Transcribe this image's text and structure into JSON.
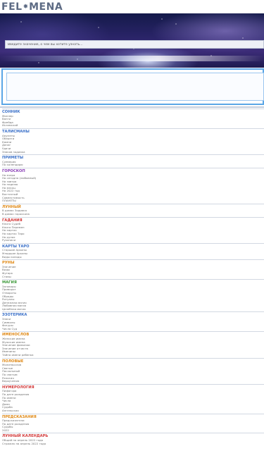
{
  "site": {
    "logo_left": "FEL",
    "logo_right": "MENA"
  },
  "search": {
    "placeholder": "Введите значение, о чем вы хотите узнать..."
  },
  "colors": {
    "blue": "#3d72c9",
    "purple": "#8a3fb6",
    "orange": "#e08a17",
    "red": "#d33a3a",
    "green": "#3f9a3c",
    "teal": "#1f8f9c"
  },
  "sections": [
    {
      "title": "СОННИК",
      "color": "#3d72c9",
      "items": [
        "Миллер",
        "Ванги",
        "Фрейда",
        "Исламский"
      ]
    },
    {
      "title": "ТАЛИСМАНЫ",
      "color": "#3d72c9",
      "items": [
        "Амулеты",
        "Обереги",
        "Камни",
        "Денег",
        "Удачи",
        "Знаков зодиака"
      ]
    },
    {
      "title": "ПРИМЕТЫ",
      "color": "#3d72c9",
      "items": [
        "Суеверия",
        "По календарю"
      ]
    },
    {
      "title": "ГОРОСКОП",
      "color": "#8a3fb6",
      "items": [
        "На вчера",
        "На сегодня (любовный)",
        "На завтра",
        "На неделю",
        "На месяц",
        "На 2022 год",
        "Восточный",
        "Совместимость",
        "ПЛАНЕТЫ"
      ]
    },
    {
      "title": "ЛУННЫЙ",
      "color": "#e08a17",
      "items": [
        "В домах Зодиака",
        "В домах гороскопа"
      ]
    },
    {
      "title": "ГАДАНИЯ",
      "color": "#d33a3a",
      "items": [
        "Книга Судеб",
        "Книга Перемен",
        "На картах",
        "На картах Таро",
        "На рунах",
        "Рукописи"
      ]
    },
    {
      "title": "КАРТЫ ТАРО",
      "color": "#3d72c9",
      "items": [
        "Старшие Арканы",
        "Младшие Арканы",
        "Виды колоды"
      ]
    },
    {
      "title": "РУНЫ",
      "color": "#e08a17",
      "items": [
        "Значение",
        "Виды",
        "Футарк",
        "Ставы"
      ]
    },
    {
      "title": "МАГИЯ",
      "color": "#3f9a3c",
      "items": [
        "Заговоры",
        "Приворот",
        "Отвороты",
        "Обряды",
        "Ритуалы",
        "Денежная магия",
        "Любовная магия",
        "Целебная магия"
      ]
    },
    {
      "title": "ЭЗОТЕРИКА",
      "color": "#3d72c9",
      "items": [
        "Знаки",
        "Символы",
        "Фигуры",
        "Числа Суд"
      ]
    },
    {
      "title": "ИМЕНОСЛОВ",
      "color": "#e08a17",
      "items": [
        "Женские имена",
        "Мужские имена",
        "Значение фамилии",
        "Значение отчеств",
        "Именины",
        "Тайна имени ребенка"
      ]
    },
    {
      "title": "ПОЛОВЫЕ",
      "color": "#e08a17",
      "items": [
        "Молитвослов",
        "Святые",
        "Пасхальный",
        "По святым",
        "Религия",
        "Вероучения"
      ]
    },
    {
      "title": "НУМЕРОЛОГИЯ",
      "color": "#d33a3a",
      "items": [
        "Пифагора",
        "По дате рождения",
        "По имени",
        "Числа",
        "Дома",
        "Судьба",
        "Ангельская"
      ]
    },
    {
      "title": "ПРЕДСКАЗАНИЯ",
      "color": "#e08a17",
      "items": [
        "Предсказатели",
        "По дате рождения",
        "Судьбы",
        "2022"
      ]
    },
    {
      "title": "ЛУННЫЙ КАЛЕНДАРЬ",
      "color": "#d33a3a",
      "items": [
        "Общий на апрель 2022 года",
        "Стрижек на апрель 2022 года"
      ]
    }
  ]
}
